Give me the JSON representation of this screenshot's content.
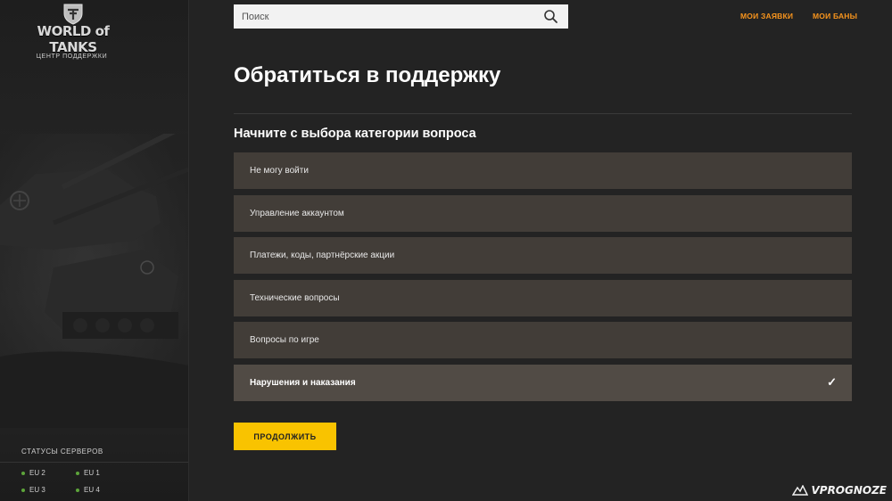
{
  "sidebar": {
    "logo_text": "WORLD of TANKS",
    "logo_subtitle": "ЦЕНТР ПОДДЕРЖКИ",
    "status_title": "СТАТУСЫ СЕРВЕРОВ",
    "servers": [
      {
        "label": "EU 2",
        "status": "online"
      },
      {
        "label": "EU 1",
        "status": "online"
      },
      {
        "label": "EU 3",
        "status": "online"
      },
      {
        "label": "EU 4",
        "status": "online"
      }
    ],
    "status_color": "#5da53a"
  },
  "header": {
    "search_placeholder": "Поиск",
    "nav": {
      "my_requests": "МОИ ЗАЯВКИ",
      "my_bans": "МОИ БАНЫ"
    },
    "accent_color": "#f7941d"
  },
  "main": {
    "title": "Обратиться в поддержку",
    "subtitle": "Начните с выбора категории вопроса",
    "categories": [
      {
        "label": "Не могу войти",
        "selected": false
      },
      {
        "label": "Управление аккаунтом",
        "selected": false
      },
      {
        "label": "Платежи, коды, партнёрские акции",
        "selected": false
      },
      {
        "label": "Технические вопросы",
        "selected": false
      },
      {
        "label": "Вопросы по игре",
        "selected": false
      },
      {
        "label": "Нарушения и наказания",
        "selected": true
      }
    ],
    "continue_label": "ПРОДОЛЖИТЬ",
    "button_color": "#f9c300"
  },
  "watermark": "VPROGNOZE"
}
